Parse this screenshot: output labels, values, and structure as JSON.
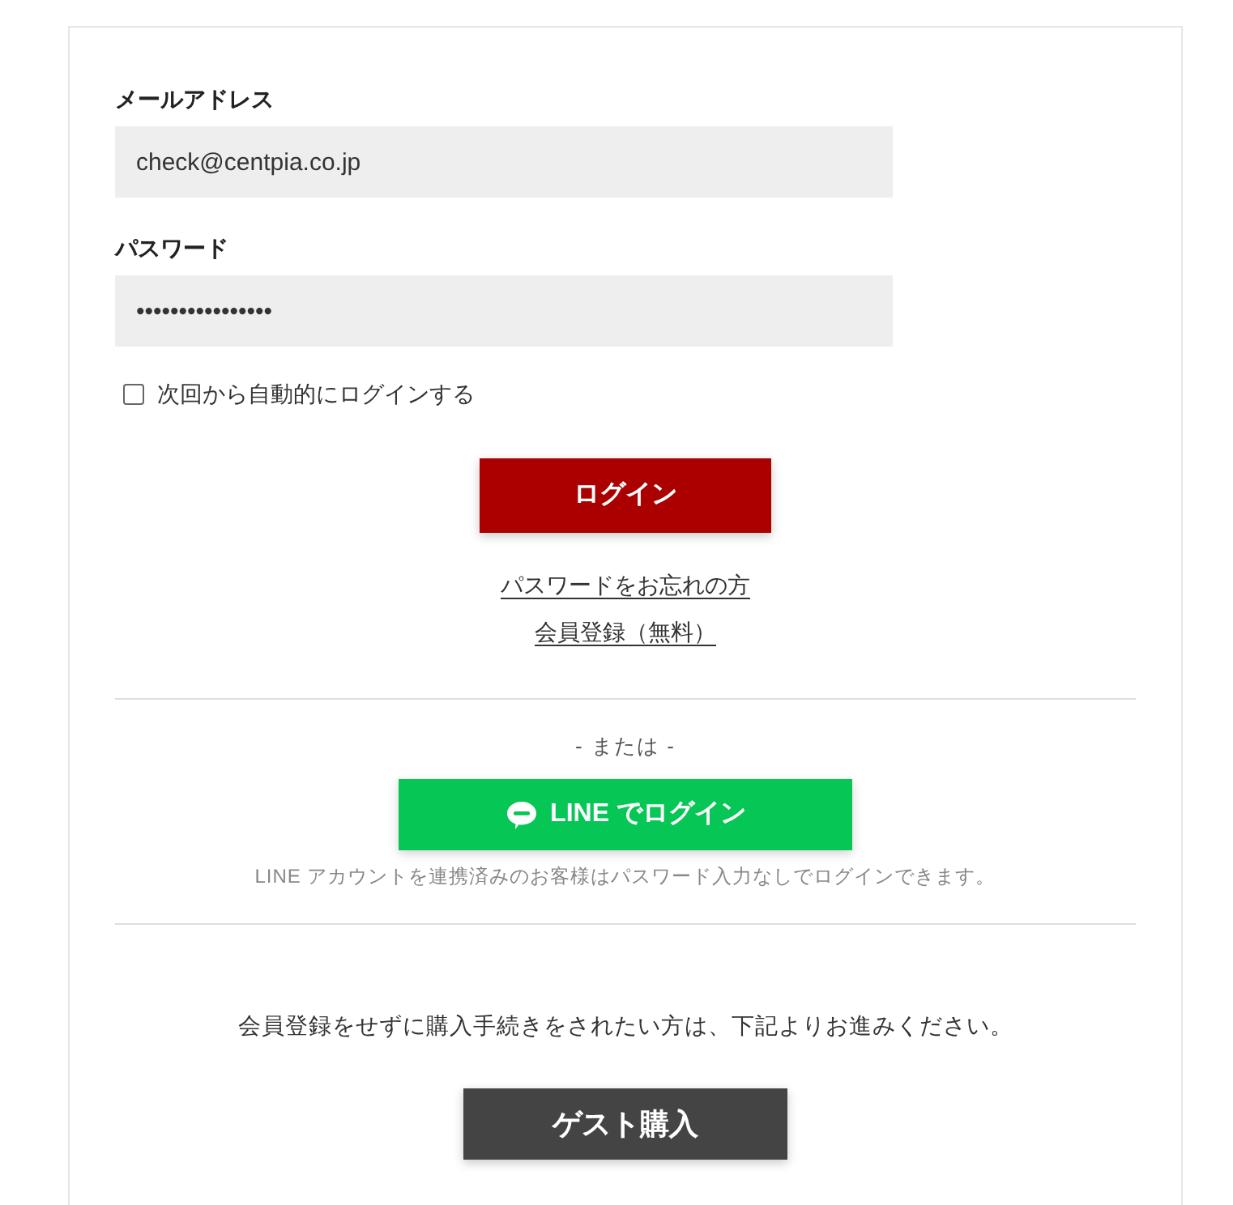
{
  "form": {
    "fields": [
      {
        "label": "メールアドレス",
        "value": "check@centpia.co.jp"
      },
      {
        "label": "パスワード",
        "value": "••••••••••••••••"
      }
    ],
    "remember": {
      "label": "次回から自動的にログインする",
      "checked": false
    },
    "login_button": "ログイン",
    "links": [
      "パスワードをお忘れの方",
      "会員登録（無料）"
    ]
  },
  "line_login": {
    "separator": "- または -",
    "button": "LINE でログイン",
    "note": "LINE アカウントを連携済みのお客様はパスワード入力なしでログインできます。"
  },
  "guest": {
    "message": "会員登録をせずに購入手続きをされたい方は、下記よりお進みください。",
    "button": "ゲスト購入"
  }
}
